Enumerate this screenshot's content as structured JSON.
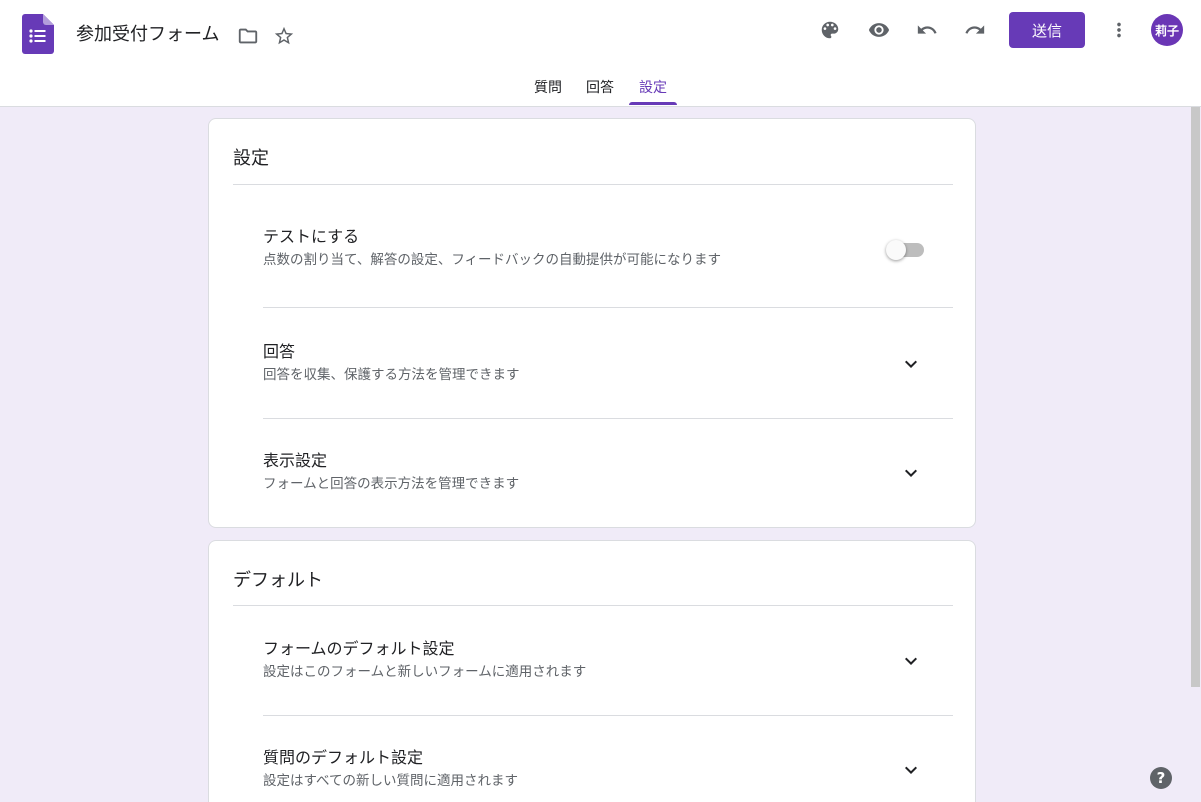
{
  "header": {
    "title": "参加受付フォーム",
    "send_label": "送信",
    "avatar_text": "莉子",
    "accent_color": "#673ab7"
  },
  "tabs": [
    {
      "label": "質問",
      "active": false
    },
    {
      "label": "回答",
      "active": false
    },
    {
      "label": "設定",
      "active": true
    }
  ],
  "settings_card": {
    "title": "設定",
    "items": [
      {
        "title": "テストにする",
        "subtitle": "点数の割り当て、解答の設定、フィードバックの自動提供が可能になります",
        "control": "toggle",
        "toggle_on": false
      },
      {
        "title": "回答",
        "subtitle": "回答を収集、保護する方法を管理できます",
        "control": "chevron-down-icon"
      },
      {
        "title": "表示設定",
        "subtitle": "フォームと回答の表示方法を管理できます",
        "control": "chevron-down-icon"
      }
    ]
  },
  "defaults_card": {
    "title": "デフォルト",
    "items": [
      {
        "title": "フォームのデフォルト設定",
        "subtitle": "設定はこのフォームと新しいフォームに適用されます",
        "control": "chevron-down-icon"
      },
      {
        "title": "質問のデフォルト設定",
        "subtitle": "設定はすべての新しい質問に適用されます",
        "control": "chevron-down-icon"
      }
    ]
  },
  "help_label": "?"
}
